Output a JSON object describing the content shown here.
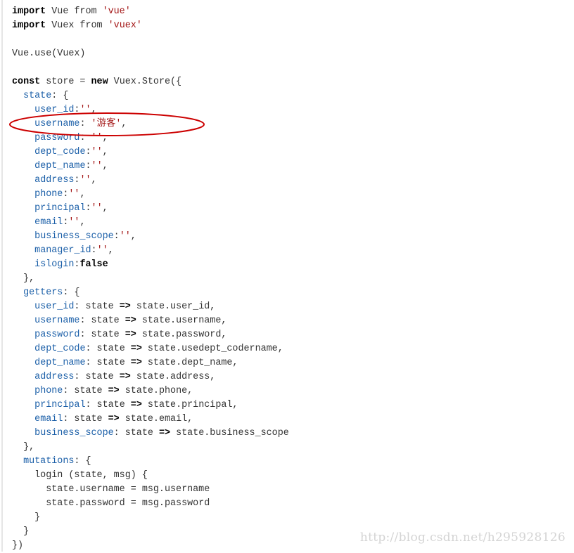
{
  "colors": {
    "keyword": "#000000",
    "string": "#a31515",
    "property": "#1b5fa8",
    "plain": "#333333",
    "annotation": "#cc0000",
    "watermark": "#d4d4d4"
  },
  "code": {
    "lines": [
      [
        {
          "t": "import",
          "c": "kw"
        },
        {
          "t": " Vue from ",
          "c": "plain"
        },
        {
          "t": "'vue'",
          "c": "str"
        }
      ],
      [
        {
          "t": "import",
          "c": "kw"
        },
        {
          "t": " Vuex from ",
          "c": "plain"
        },
        {
          "t": "'vuex'",
          "c": "str"
        }
      ],
      [],
      [
        {
          "t": "Vue.use(Vuex)",
          "c": "plain"
        }
      ],
      [],
      [
        {
          "t": "const",
          "c": "kw"
        },
        {
          "t": " store = ",
          "c": "plain"
        },
        {
          "t": "new",
          "c": "kw"
        },
        {
          "t": " Vuex.Store({",
          "c": "plain"
        }
      ],
      [
        {
          "t": "  ",
          "c": "plain"
        },
        {
          "t": "state",
          "c": "prop"
        },
        {
          "t": ": {",
          "c": "plain"
        }
      ],
      [
        {
          "t": "    ",
          "c": "plain"
        },
        {
          "t": "user_id",
          "c": "prop"
        },
        {
          "t": ":",
          "c": "plain"
        },
        {
          "t": "''",
          "c": "str"
        },
        {
          "t": ",",
          "c": "plain"
        }
      ],
      [
        {
          "t": "    ",
          "c": "plain"
        },
        {
          "t": "username",
          "c": "prop"
        },
        {
          "t": ": ",
          "c": "plain"
        },
        {
          "t": "'游客'",
          "c": "str"
        },
        {
          "t": ",",
          "c": "plain"
        }
      ],
      [
        {
          "t": "    ",
          "c": "plain"
        },
        {
          "t": "password",
          "c": "prop"
        },
        {
          "t": ": ",
          "c": "plain"
        },
        {
          "t": "''",
          "c": "str"
        },
        {
          "t": ",",
          "c": "plain"
        }
      ],
      [
        {
          "t": "    ",
          "c": "plain"
        },
        {
          "t": "dept_code",
          "c": "prop"
        },
        {
          "t": ":",
          "c": "plain"
        },
        {
          "t": "''",
          "c": "str"
        },
        {
          "t": ",",
          "c": "plain"
        }
      ],
      [
        {
          "t": "    ",
          "c": "plain"
        },
        {
          "t": "dept_name",
          "c": "prop"
        },
        {
          "t": ":",
          "c": "plain"
        },
        {
          "t": "''",
          "c": "str"
        },
        {
          "t": ",",
          "c": "plain"
        }
      ],
      [
        {
          "t": "    ",
          "c": "plain"
        },
        {
          "t": "address",
          "c": "prop"
        },
        {
          "t": ":",
          "c": "plain"
        },
        {
          "t": "''",
          "c": "str"
        },
        {
          "t": ",",
          "c": "plain"
        }
      ],
      [
        {
          "t": "    ",
          "c": "plain"
        },
        {
          "t": "phone",
          "c": "prop"
        },
        {
          "t": ":",
          "c": "plain"
        },
        {
          "t": "''",
          "c": "str"
        },
        {
          "t": ",",
          "c": "plain"
        }
      ],
      [
        {
          "t": "    ",
          "c": "plain"
        },
        {
          "t": "principal",
          "c": "prop"
        },
        {
          "t": ":",
          "c": "plain"
        },
        {
          "t": "''",
          "c": "str"
        },
        {
          "t": ",",
          "c": "plain"
        }
      ],
      [
        {
          "t": "    ",
          "c": "plain"
        },
        {
          "t": "email",
          "c": "prop"
        },
        {
          "t": ":",
          "c": "plain"
        },
        {
          "t": "''",
          "c": "str"
        },
        {
          "t": ",",
          "c": "plain"
        }
      ],
      [
        {
          "t": "    ",
          "c": "plain"
        },
        {
          "t": "business_scope",
          "c": "prop"
        },
        {
          "t": ":",
          "c": "plain"
        },
        {
          "t": "''",
          "c": "str"
        },
        {
          "t": ",",
          "c": "plain"
        }
      ],
      [
        {
          "t": "    ",
          "c": "plain"
        },
        {
          "t": "manager_id",
          "c": "prop"
        },
        {
          "t": ":",
          "c": "plain"
        },
        {
          "t": "''",
          "c": "str"
        },
        {
          "t": ",",
          "c": "plain"
        }
      ],
      [
        {
          "t": "    ",
          "c": "plain"
        },
        {
          "t": "islogin",
          "c": "prop"
        },
        {
          "t": ":",
          "c": "plain"
        },
        {
          "t": "false",
          "c": "kw"
        }
      ],
      [
        {
          "t": "  },",
          "c": "plain"
        }
      ],
      [
        {
          "t": "  ",
          "c": "plain"
        },
        {
          "t": "getters",
          "c": "prop"
        },
        {
          "t": ": {",
          "c": "plain"
        }
      ],
      [
        {
          "t": "    ",
          "c": "plain"
        },
        {
          "t": "user_id",
          "c": "prop"
        },
        {
          "t": ": state ",
          "c": "plain"
        },
        {
          "t": "=>",
          "c": "kw"
        },
        {
          "t": " state.user_id,",
          "c": "plain"
        }
      ],
      [
        {
          "t": "    ",
          "c": "plain"
        },
        {
          "t": "username",
          "c": "prop"
        },
        {
          "t": ": state ",
          "c": "plain"
        },
        {
          "t": "=>",
          "c": "kw"
        },
        {
          "t": " state.username,",
          "c": "plain"
        }
      ],
      [
        {
          "t": "    ",
          "c": "plain"
        },
        {
          "t": "password",
          "c": "prop"
        },
        {
          "t": ": state ",
          "c": "plain"
        },
        {
          "t": "=>",
          "c": "kw"
        },
        {
          "t": " state.password,",
          "c": "plain"
        }
      ],
      [
        {
          "t": "    ",
          "c": "plain"
        },
        {
          "t": "dept_code",
          "c": "prop"
        },
        {
          "t": ": state ",
          "c": "plain"
        },
        {
          "t": "=>",
          "c": "kw"
        },
        {
          "t": " state.usedept_codername,",
          "c": "plain"
        }
      ],
      [
        {
          "t": "    ",
          "c": "plain"
        },
        {
          "t": "dept_name",
          "c": "prop"
        },
        {
          "t": ": state ",
          "c": "plain"
        },
        {
          "t": "=>",
          "c": "kw"
        },
        {
          "t": " state.dept_name,",
          "c": "plain"
        }
      ],
      [
        {
          "t": "    ",
          "c": "plain"
        },
        {
          "t": "address",
          "c": "prop"
        },
        {
          "t": ": state ",
          "c": "plain"
        },
        {
          "t": "=>",
          "c": "kw"
        },
        {
          "t": " state.address,",
          "c": "plain"
        }
      ],
      [
        {
          "t": "    ",
          "c": "plain"
        },
        {
          "t": "phone",
          "c": "prop"
        },
        {
          "t": ": state ",
          "c": "plain"
        },
        {
          "t": "=>",
          "c": "kw"
        },
        {
          "t": " state.phone,",
          "c": "plain"
        }
      ],
      [
        {
          "t": "    ",
          "c": "plain"
        },
        {
          "t": "principal",
          "c": "prop"
        },
        {
          "t": ": state ",
          "c": "plain"
        },
        {
          "t": "=>",
          "c": "kw"
        },
        {
          "t": " state.principal,",
          "c": "plain"
        }
      ],
      [
        {
          "t": "    ",
          "c": "plain"
        },
        {
          "t": "email",
          "c": "prop"
        },
        {
          "t": ": state ",
          "c": "plain"
        },
        {
          "t": "=>",
          "c": "kw"
        },
        {
          "t": " state.email,",
          "c": "plain"
        }
      ],
      [
        {
          "t": "    ",
          "c": "plain"
        },
        {
          "t": "business_scope",
          "c": "prop"
        },
        {
          "t": ": state ",
          "c": "plain"
        },
        {
          "t": "=>",
          "c": "kw"
        },
        {
          "t": " state.business_scope",
          "c": "plain"
        }
      ],
      [
        {
          "t": "  },",
          "c": "plain"
        }
      ],
      [
        {
          "t": "  ",
          "c": "plain"
        },
        {
          "t": "mutations",
          "c": "prop"
        },
        {
          "t": ": {",
          "c": "plain"
        }
      ],
      [
        {
          "t": "    login (state, msg) {",
          "c": "plain"
        }
      ],
      [
        {
          "t": "      state.username = msg.username",
          "c": "plain"
        }
      ],
      [
        {
          "t": "      state.password = msg.password",
          "c": "plain"
        }
      ],
      [
        {
          "t": "    }",
          "c": "plain"
        }
      ],
      [
        {
          "t": "  }",
          "c": "plain"
        }
      ],
      [
        {
          "t": "})",
          "c": "plain"
        }
      ]
    ]
  },
  "watermark": {
    "text": "http://blog.csdn.net/h295928126"
  }
}
